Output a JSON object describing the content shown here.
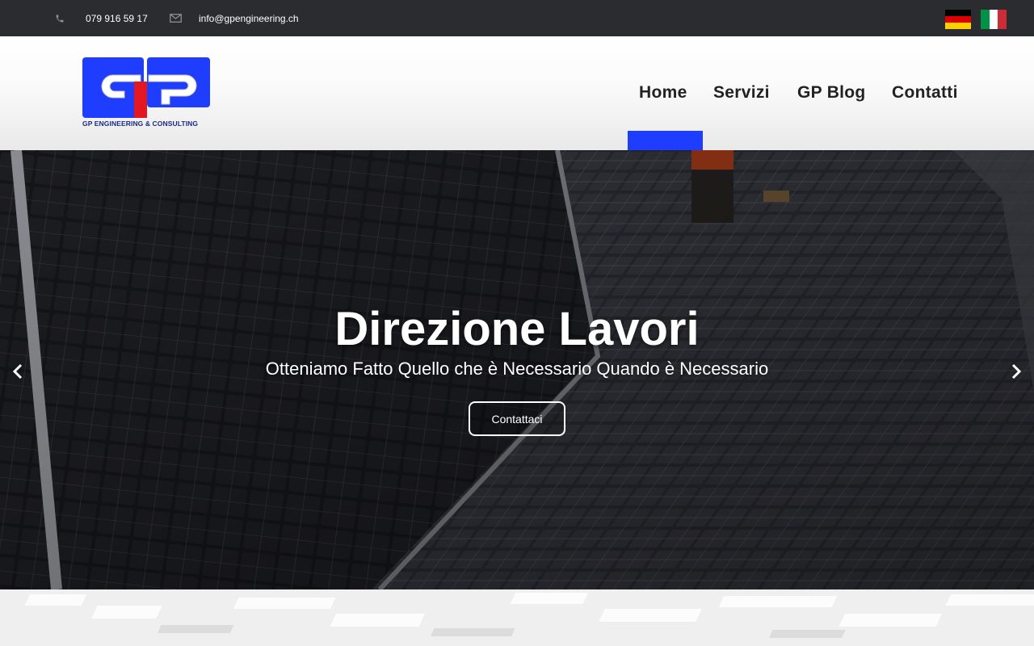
{
  "topbar": {
    "phone": "079 916 59 17",
    "email": "info@gpengineering.ch",
    "phone_icon": "phone-icon",
    "email_icon": "envelope-icon",
    "languages": [
      {
        "name": "german-flag-icon",
        "colors": [
          "#000000",
          "#dd0000",
          "#ffce00"
        ]
      },
      {
        "name": "italian-flag-icon",
        "colors": [
          "#009246",
          "#ffffff",
          "#ce2b37"
        ]
      }
    ]
  },
  "brand": {
    "logo_caption": "GP ENGINEERING & CONSULTING",
    "colors": {
      "blue": "#1e3dff",
      "red": "#e4161f"
    }
  },
  "nav": {
    "items": [
      {
        "label": "Home",
        "active": true
      },
      {
        "label": "Servizi"
      },
      {
        "label": "GP Blog"
      },
      {
        "label": "Contatti"
      }
    ],
    "active_color": "#1e3dff"
  },
  "hero": {
    "title": "Direzione Lavori",
    "subtitle": "Otteniamo Fatto Quello che è Necessario Quando è Necessario",
    "button": "Contattaci",
    "prev_icon": "chevron-left-icon",
    "next_icon": "chevron-right-icon"
  }
}
